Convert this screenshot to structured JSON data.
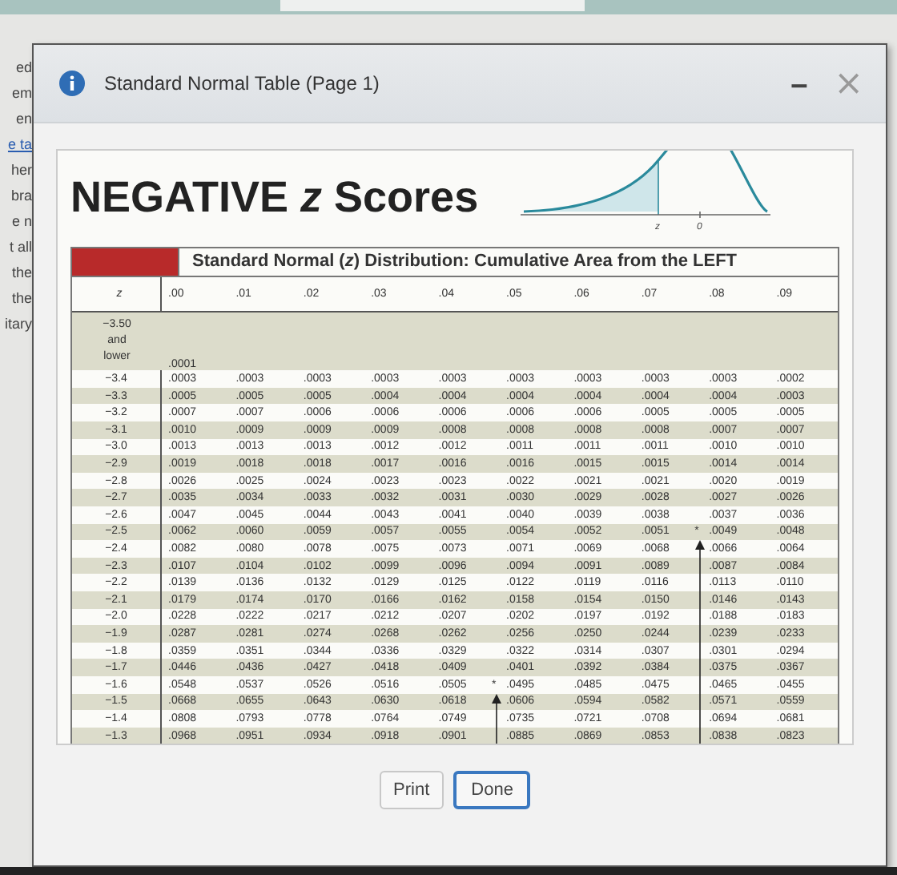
{
  "background_text": [
    "ed",
    "em",
    "en",
    "e ta",
    "her",
    "bra",
    "e n",
    "t all",
    "the",
    "the",
    "itary"
  ],
  "dialog": {
    "title": "Standard Normal Table (Page 1)",
    "minimize": "‒",
    "close": "×"
  },
  "heading": "NEGATIVE *z* Scores",
  "figure": {
    "z_label": "z",
    "zero_label": "0"
  },
  "table": {
    "caption": "Standard Normal (*z*) Distribution: Cumulative Area from the LEFT",
    "z_header": "z",
    "columns": [
      ".00",
      ".01",
      ".02",
      ".03",
      ".04",
      ".05",
      ".06",
      ".07",
      ".08",
      ".09"
    ],
    "rows": [
      {
        "z": "−3.50 and lower",
        "cells": [
          ".0001"
        ]
      },
      {
        "z": "−3.4",
        "cells": [
          ".0003",
          ".0003",
          ".0003",
          ".0003",
          ".0003",
          ".0003",
          ".0003",
          ".0003",
          ".0003",
          ".0002"
        ]
      },
      {
        "z": "−3.3",
        "cells": [
          ".0005",
          ".0005",
          ".0005",
          ".0004",
          ".0004",
          ".0004",
          ".0004",
          ".0004",
          ".0004",
          ".0003"
        ]
      },
      {
        "z": "−3.2",
        "cells": [
          ".0007",
          ".0007",
          ".0006",
          ".0006",
          ".0006",
          ".0006",
          ".0006",
          ".0005",
          ".0005",
          ".0005"
        ]
      },
      {
        "z": "−3.1",
        "cells": [
          ".0010",
          ".0009",
          ".0009",
          ".0009",
          ".0008",
          ".0008",
          ".0008",
          ".0008",
          ".0007",
          ".0007"
        ]
      },
      {
        "z": "−3.0",
        "cells": [
          ".0013",
          ".0013",
          ".0013",
          ".0012",
          ".0012",
          ".0011",
          ".0011",
          ".0011",
          ".0010",
          ".0010"
        ]
      },
      {
        "z": "−2.9",
        "cells": [
          ".0019",
          ".0018",
          ".0018",
          ".0017",
          ".0016",
          ".0016",
          ".0015",
          ".0015",
          ".0014",
          ".0014"
        ]
      },
      {
        "z": "−2.8",
        "cells": [
          ".0026",
          ".0025",
          ".0024",
          ".0023",
          ".0023",
          ".0022",
          ".0021",
          ".0021",
          ".0020",
          ".0019"
        ]
      },
      {
        "z": "−2.7",
        "cells": [
          ".0035",
          ".0034",
          ".0033",
          ".0032",
          ".0031",
          ".0030",
          ".0029",
          ".0028",
          ".0027",
          ".0026"
        ]
      },
      {
        "z": "−2.6",
        "cells": [
          ".0047",
          ".0045",
          ".0044",
          ".0043",
          ".0041",
          ".0040",
          ".0039",
          ".0038",
          ".0037",
          ".0036"
        ]
      },
      {
        "z": "−2.5",
        "cells": [
          ".0062",
          ".0060",
          ".0059",
          ".0057",
          ".0055",
          ".0054",
          ".0052",
          ".0051",
          {
            "value": ".0049",
            "asterisk": "*"
          },
          ".0048"
        ]
      },
      {
        "z": "−2.4",
        "cells": [
          ".0082",
          ".0080",
          ".0078",
          ".0075",
          ".0073",
          ".0071",
          ".0069",
          ".0068",
          ".0066",
          ".0064"
        ]
      },
      {
        "z": "−2.3",
        "cells": [
          ".0107",
          ".0104",
          ".0102",
          ".0099",
          ".0096",
          ".0094",
          ".0091",
          ".0089",
          ".0087",
          ".0084"
        ]
      },
      {
        "z": "−2.2",
        "cells": [
          ".0139",
          ".0136",
          ".0132",
          ".0129",
          ".0125",
          ".0122",
          ".0119",
          ".0116",
          ".0113",
          ".0110"
        ]
      },
      {
        "z": "−2.1",
        "cells": [
          ".0179",
          ".0174",
          ".0170",
          ".0166",
          ".0162",
          ".0158",
          ".0154",
          ".0150",
          ".0146",
          ".0143"
        ]
      },
      {
        "z": "−2.0",
        "cells": [
          ".0228",
          ".0222",
          ".0217",
          ".0212",
          ".0207",
          ".0202",
          ".0197",
          ".0192",
          ".0188",
          ".0183"
        ]
      },
      {
        "z": "−1.9",
        "cells": [
          ".0287",
          ".0281",
          ".0274",
          ".0268",
          ".0262",
          ".0256",
          ".0250",
          ".0244",
          ".0239",
          ".0233"
        ]
      },
      {
        "z": "−1.8",
        "cells": [
          ".0359",
          ".0351",
          ".0344",
          ".0336",
          ".0329",
          ".0322",
          ".0314",
          ".0307",
          ".0301",
          ".0294"
        ]
      },
      {
        "z": "−1.7",
        "cells": [
          ".0446",
          ".0436",
          ".0427",
          ".0418",
          ".0409",
          ".0401",
          ".0392",
          ".0384",
          ".0375",
          ".0367"
        ]
      },
      {
        "z": "−1.6",
        "cells": [
          ".0548",
          ".0537",
          ".0526",
          ".0516",
          ".0505",
          {
            "value": ".0495",
            "asterisk": "*"
          },
          ".0485",
          ".0475",
          ".0465",
          ".0455"
        ]
      },
      {
        "z": "−1.5",
        "cells": [
          ".0668",
          ".0655",
          ".0643",
          ".0630",
          ".0618",
          ".0606",
          ".0594",
          ".0582",
          ".0571",
          ".0559"
        ]
      },
      {
        "z": "−1.4",
        "cells": [
          ".0808",
          ".0793",
          ".0778",
          ".0764",
          ".0749",
          ".0735",
          ".0721",
          ".0708",
          ".0694",
          ".0681"
        ]
      },
      {
        "z": "−1.3",
        "cells": [
          ".0968",
          ".0951",
          ".0934",
          ".0918",
          ".0901",
          ".0885",
          ".0869",
          ".0853",
          ".0838",
          ".0823"
        ]
      }
    ]
  },
  "buttons": [
    {
      "label": "Print",
      "selected": false
    },
    {
      "label": "Done",
      "selected": true
    }
  ]
}
